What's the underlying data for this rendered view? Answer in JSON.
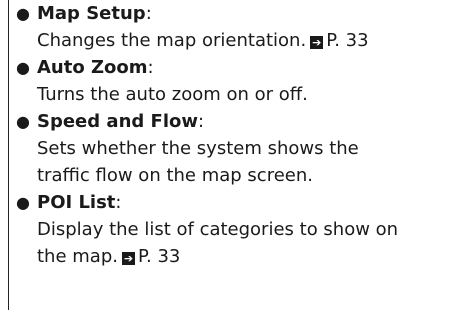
{
  "items": [
    {
      "term": "Map Setup",
      "colon": ":",
      "lines": [
        "Changes the map orientation."
      ],
      "ref": {
        "icon": "arrow-right-box-icon",
        "page": "P. 33"
      }
    },
    {
      "term": "Auto Zoom",
      "colon": ":",
      "lines": [
        "Turns the auto zoom on or off."
      ]
    },
    {
      "term": "Speed and Flow",
      "colon": ":",
      "lines": [
        "Sets whether the system shows the",
        "traffic flow on the map screen."
      ]
    },
    {
      "term": "POI List",
      "colon": ":",
      "lines": [
        "Display the list of categories to show on",
        "the map."
      ],
      "ref": {
        "icon": "arrow-right-box-icon",
        "page": "P. 33"
      }
    }
  ],
  "bullet": "●",
  "ref_glyph": "➔"
}
